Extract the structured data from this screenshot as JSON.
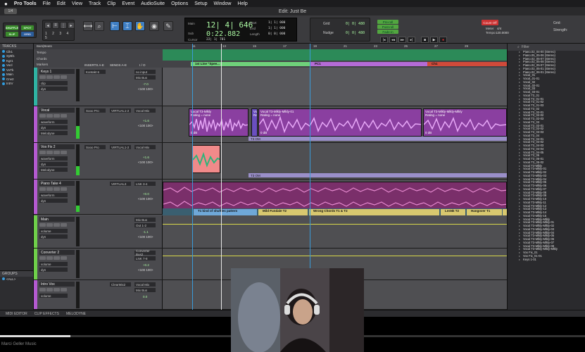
{
  "menubar": {
    "apple": "",
    "app": "Pro Tools",
    "items": [
      "File",
      "Edit",
      "View",
      "Track",
      "Clip",
      "Event",
      "AudioSuite",
      "Options",
      "Setup",
      "Window",
      "Help"
    ]
  },
  "window": {
    "title": "Edit: Just Be",
    "zoom_label": "1/4"
  },
  "toolbar": {
    "modes": [
      "SHUFFLE",
      "SPOT",
      "SLIP",
      "GRID"
    ],
    "counter_main": "12| 4| 646",
    "counter_sub": "0:22.882",
    "counter_labels": {
      "main": "Main",
      "sub": "Sub",
      "cursor": "Cursor",
      "start": "Start",
      "end": "End",
      "length": "Length"
    },
    "cursor_value": "22| 1| 781",
    "start_value": "1| 1| 000",
    "end_value": "1| 1| 000",
    "length_value": "0| 0| 000",
    "grid_label": "Grid",
    "nudge_label": "Nudge",
    "grid_value": "0| 0| 480",
    "nudge_value": "0| 0| 480",
    "preroll_label": "Pre-roll",
    "postroll_label": "Post-roll",
    "fadein_label": "Fade-in",
    "count_off": "Count Off",
    "meter_label": "Meter",
    "tempo_label": "Tempo",
    "tempo_value": "120.0000",
    "meter_value": "4/4",
    "grid_right": "Grid:",
    "strength": "Strength:"
  },
  "tracklist": {
    "header": "TRACKS",
    "items": [
      {
        "name": "Clk1",
        "color": "#2f9de0"
      },
      {
        "name": "SyBl1",
        "color": "#2f9de0"
      },
      {
        "name": "Kgr1",
        "color": "#2f9de0"
      },
      {
        "name": "Vocl",
        "color": "#2f9de0"
      },
      {
        "name": "VxTk",
        "color": "#2f9de0"
      },
      {
        "name": "Main",
        "color": "#2f9de0"
      },
      {
        "name": "Cnv2",
        "color": "#2f9de0"
      },
      {
        "name": "IntrV",
        "color": "#2f9de0"
      }
    ]
  },
  "groups": {
    "header": "GROUPS",
    "item": "<ALL>"
  },
  "rulers": {
    "bars_label": "Bars|Beats",
    "tempo_label": "Tempo",
    "chords_label": "Chords",
    "markers_label": "Markers",
    "bar_numbers": [
      "11",
      "13",
      "15",
      "17",
      "19",
      "21",
      "23",
      "25",
      "27",
      "29"
    ],
    "markers": [
      {
        "label": "1st Line \"Spee...",
        "color": "#6fd07a"
      },
      {
        "label": "PC1",
        "color": "#b46bd6"
      },
      {
        "label": "Ch1",
        "color": "#d04a3a"
      }
    ]
  },
  "tracks": [
    {
      "name": "Keys 1",
      "color": "#2fb3a3",
      "field1": "clip",
      "field2": "dyn",
      "inserts_header": "INSERTS A-E",
      "sends_header": "SENDS A-E",
      "io_header": "I / O",
      "insert": "Kontakt 6",
      "io_in": "no input",
      "io_out": "Mix Bus",
      "vol": "-7.0",
      "pan": "<100 100>"
    },
    {
      "name": "Vocal",
      "color": "#b45ad0",
      "field1": "waveform",
      "field2": "dyn",
      "insert": "Sooo Pro",
      "io_in": "VIRTUAL1-2",
      "io_out": "Vocal Mix",
      "vol": "+1.6",
      "pan": "<100 100>",
      "extra": "Melodyne"
    },
    {
      "name": "Vox Fix 2",
      "color": "#b45ad0",
      "field1": "waveform",
      "field2": "dyn",
      "insert": "Sooo Pro",
      "io_in": "VIRTUAL1-2",
      "io_out": "Vocal Mix",
      "vol": "+1.6",
      "pan": "<100 100>",
      "extra": "Melodyne"
    },
    {
      "name": "Piano Take 4",
      "color": "#b45ad0",
      "field1": "waveform",
      "field2": "dyn",
      "io_in": "VIRTUAL3",
      "io_out": "LNK 3-4",
      "vol": "+0.0",
      "pan": "<100 100>"
    },
    {
      "name": "Main",
      "color": "#6fd04a",
      "field1": "volume",
      "field2": "dyn",
      "io_in": "Mix Bus",
      "io_out": "Out 1-2",
      "vol": "-1.1",
      "pan": "<100 100>"
    },
    {
      "name": "Converter 2",
      "color": "#6fd04a",
      "field1": "volume",
      "field2": "dyn",
      "io_in": "Converter Bus2",
      "io_out": "LNK 7-8",
      "vol": "+0.2",
      "pan": "<100 100>"
    },
    {
      "name": "Intro Vox",
      "color": "#b45ad0",
      "field1": "volume",
      "field2": "",
      "insert": "ClearMix2",
      "io_in": "Vocal Mix",
      "io_out": "Mix Bus",
      "vol": "0.0",
      "pan": ""
    }
  ],
  "clips": {
    "vocal_a": "Vocal T3-Mlkly\nRating = none",
    "vocal_b": "Vo\nRa",
    "vocal_c": "Vocal T3-Mlkly-Mlkly-01\nRating = none",
    "vocal_d": "Vocal T3-Mlkly-Mlkly-Mlkly\nRating = none",
    "vocal_gain": "0 dB",
    "vocal_footer": "T3 OM",
    "voxfix_footer": "T3 OM",
    "chords": [
      {
        "label": "T1 kind of shuffles pattern",
        "color": "#7a7ad8"
      },
      {
        "label": "Mild Fundale T2",
        "color": "#7a7ad8"
      },
      {
        "label": "Wrong Chords T1 & T2",
        "color": "#7a7ad8"
      },
      {
        "label": "LesNk T2",
        "color": "#7a7ad8"
      },
      {
        "label": "Hangover T1",
        "color": "#7a7ad8"
      },
      {
        "label": "A",
        "color": "#7a7ad8"
      }
    ]
  },
  "cliplist": {
    "filter": "Filter",
    "items": [
      "Piano.02_04-00 (Stereo)",
      "Piano.05_05-06 (Stereo)",
      "Piano.02_05-07 (Stereo)",
      "Piano.02_05-08 (Stereo)",
      "Piano.02_05-07 (Stereo)",
      "Piano.02_05-01 (Stereo)",
      "Piano.02_06-01 (Stereo)",
      "Vocal_01",
      "Vocal_01-01",
      "Vocal_02",
      "Vocal_02-01",
      "Vocal_03",
      "Vocal_03-01",
      "Vocal T3_01",
      "Vocal T3_01-01",
      "Vocal T3_01-02",
      "Vocal T3_01-03",
      "Vocal T3_02",
      "Vocal T3_02-01",
      "Vocal T3_02-02",
      "Vocal T3_02-03",
      "Vocal T3_03",
      "Vocal T3_03-01",
      "Vocal T3_03-02",
      "Vocal T3_03-03",
      "Vocal T3_04",
      "Vocal T3_04-01",
      "Vocal T3_04-02",
      "Vocal T3_04-03",
      "Vocal T3_04-04",
      "Vocal T3_04-05",
      "Vocal T3_05",
      "Vocal T3_05-01",
      "Vocal T3_05-02",
      "Vocal T3-Mlkly",
      "Vocal T3-Mlkly-01",
      "Vocal T3-Mlkly-02",
      "Vocal T3-Mlkly-03",
      "Vocal T3-Mlkly-04",
      "Vocal T3-Mlkly-05",
      "Vocal T3-Mlkly-06",
      "Vocal T3-Mlkly-07",
      "Vocal T3-Mlkly-08",
      "Vocal T3-Mlkly-09",
      "Vocal T3-Mlkly-10",
      "Vocal T3-Mlkly-11",
      "Vocal T3-Mlkly-12",
      "Vocal T3-Mlkly-13",
      "Vocal T3-Mlkly-14",
      "Vocal T3-Mlkly-15",
      "Vocal T3-Mlkly-Mlkly",
      "Vocal T3-Mlkly-Mlkly-01",
      "Vocal T3-Mlkly-Mlkly-02",
      "Vocal T3-Mlkly-Mlkly-03",
      "Vocal T3-Mlkly-Mlkly-04",
      "Vocal T3-Mlkly-Mlkly-05",
      "Vocal T3-Mlkly-Mlkly-06",
      "Vocal T3-Mlkly-Mlkly-07",
      "Vocal T3-Mlkly-Mlkly-08",
      "Vocal T3-Mlkly-Mlkly-Mlkly",
      "Vox Fix_01",
      "Vox Fix_01-01",
      "Keys 1-01"
    ]
  },
  "bottombar": {
    "midi_editor": "MIDI EDITOR",
    "clip_effects": "CLIP EFFECTS",
    "melodyne": "MELODYNE"
  },
  "video": {
    "caption": "Marci Geller Music",
    "progress": 0.12
  }
}
